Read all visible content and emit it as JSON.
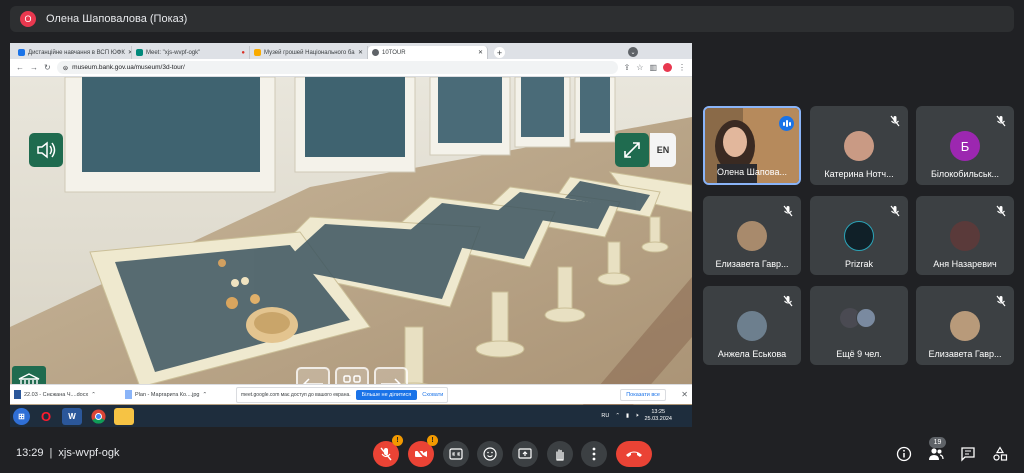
{
  "presenter": {
    "avatar_letter": "О",
    "title": "Олена Шаповалова (Показ)"
  },
  "browser": {
    "tabs": [
      {
        "label": "Дистанційне навчання в ВСП ЮФК",
        "active": false
      },
      {
        "label": "Meet: \"xjs-wvpf-ogk\"",
        "active": false
      },
      {
        "label": "Музей грошей Національного ба",
        "active": false
      },
      {
        "label": "10TOUR",
        "active": true
      }
    ],
    "url": "museum.bank.gov.ua/museum/3d-tour/"
  },
  "tour": {
    "lang_button": "EN"
  },
  "downloads": {
    "items": [
      {
        "label": "22.03 - Снєжана Ч....docx",
        "kind": "doc"
      },
      {
        "label": "Plan - Маргарита Ко....jpg",
        "kind": "img"
      }
    ],
    "share_notice": "meet.google.com має доступ до вашого екрана.",
    "stop_share": "Більше не ділитися",
    "hide": "Сховати",
    "show_all": "Показати все"
  },
  "taskbar": {
    "word_label": "W",
    "lang": "RU",
    "time": "13:25",
    "date": "25.03.2024"
  },
  "participants": [
    {
      "name": "Олена Шапова...",
      "avatar": "",
      "speaking": true
    },
    {
      "name": "Катерина Нотч...",
      "avatar": "",
      "speaking": false
    },
    {
      "name": "Білокобильськ...",
      "avatar": "Б",
      "speaking": false
    },
    {
      "name": "Елизавета Гавр...",
      "avatar": "",
      "speaking": false
    },
    {
      "name": "Prizrak",
      "avatar": "",
      "speaking": false
    },
    {
      "name": "Аня Назаревич",
      "avatar": "",
      "speaking": false
    },
    {
      "name": "Анжела Еськова",
      "avatar": "",
      "speaking": false
    },
    {
      "name": "Ещё 9 чел.",
      "avatar": "",
      "speaking": false
    },
    {
      "name": "Елизавета Гавр...",
      "avatar": "",
      "speaking": false
    }
  ],
  "meeting": {
    "time": "13:29",
    "separator": "|",
    "code": "xjs-wvpf-ogk",
    "mic_badge": "!",
    "cam_badge": "!",
    "people_count": "19"
  },
  "colors": {
    "background": "#202124",
    "tile": "#3c4043",
    "hangup": "#ea4335",
    "tour_green": "#1f6b4f",
    "speaking_border": "#8ab4f8",
    "avatar_purple": "#9c27b0"
  }
}
